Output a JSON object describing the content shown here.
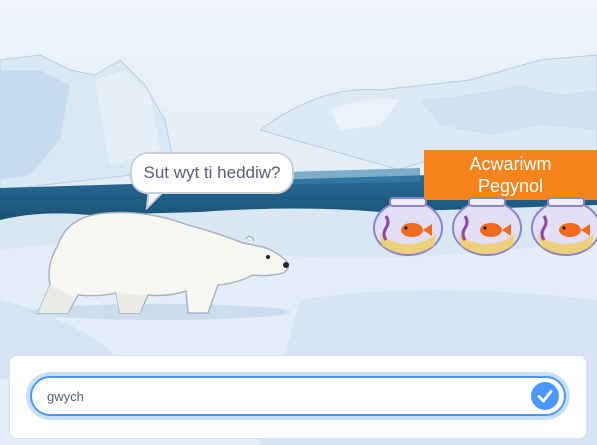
{
  "sprite_speech": {
    "text": "Sut wyt ti heddiw?"
  },
  "sign": {
    "line1": "Acwariwm",
    "line2": "Pegynol",
    "color": "#f5841c"
  },
  "fish_bowls": [
    {
      "icon": "fishbowl-icon"
    },
    {
      "icon": "fishbowl-icon"
    },
    {
      "icon": "fishbowl-icon"
    }
  ],
  "ask_prompt": {
    "answer_value": "gwych",
    "submit_icon": "check-icon",
    "accent_color": "#4c97ff"
  },
  "backdrop": {
    "theme": "arctic",
    "sky": "#dbe8f4",
    "water": "#1e5d86"
  }
}
